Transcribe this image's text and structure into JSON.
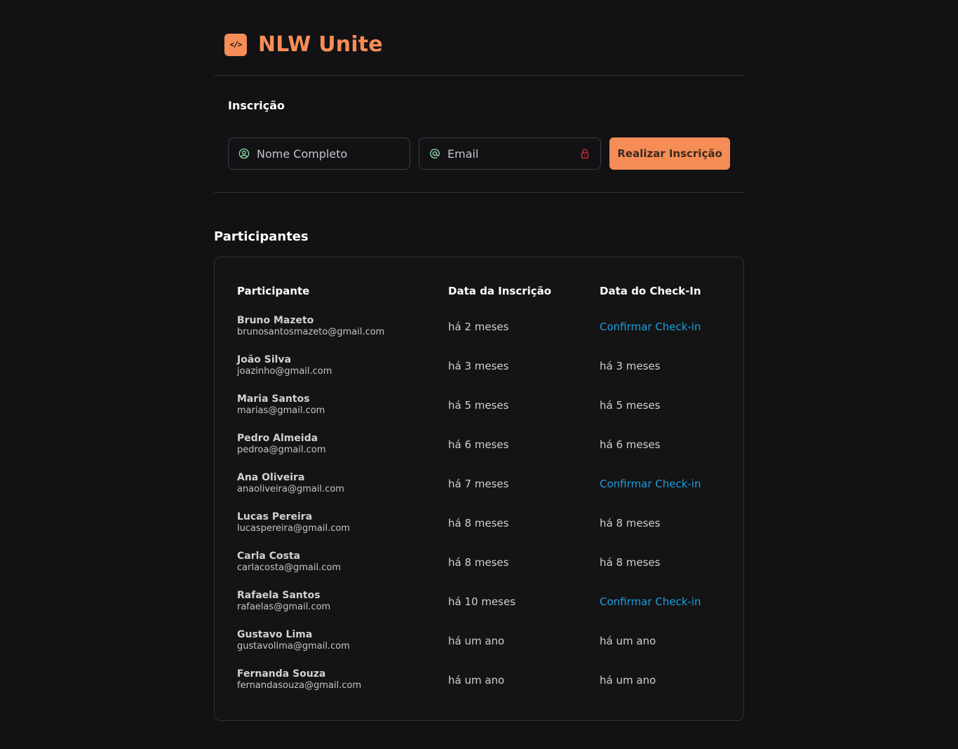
{
  "header": {
    "logo_glyph": "</>",
    "title": "NLW Unite"
  },
  "form": {
    "title": "Inscrição",
    "name_placeholder": "Nome Completo",
    "email_placeholder": "Email",
    "submit_label": "Realizar Inscrição",
    "icons": {
      "name": "user-circle-icon",
      "email": "at-sign-icon",
      "password_manager": "lock-icon"
    }
  },
  "participants": {
    "title": "Participantes",
    "columns": [
      "Participante",
      "Data da Inscrição",
      "Data do Check-In"
    ],
    "rows": [
      {
        "name": "Bruno Mazeto",
        "email": "brunosantosmazeto@gmail.com",
        "subscribed": "há 2 meses",
        "checkin": "Confirmar Check-in",
        "checkin_is_action": true
      },
      {
        "name": "João Silva",
        "email": "joazinho@gmail.com",
        "subscribed": "há 3 meses",
        "checkin": "há 3 meses",
        "checkin_is_action": false
      },
      {
        "name": "Maria Santos",
        "email": "marias@gmail.com",
        "subscribed": "há 5 meses",
        "checkin": "há 5 meses",
        "checkin_is_action": false
      },
      {
        "name": "Pedro Almeida",
        "email": "pedroa@gmail.com",
        "subscribed": "há 6 meses",
        "checkin": "há 6 meses",
        "checkin_is_action": false
      },
      {
        "name": "Ana Oliveira",
        "email": "anaoliveira@gmail.com",
        "subscribed": "há 7 meses",
        "checkin": "Confirmar Check-in",
        "checkin_is_action": true
      },
      {
        "name": "Lucas Pereira",
        "email": "lucaspereira@gmail.com",
        "subscribed": "há 8 meses",
        "checkin": "há 8 meses",
        "checkin_is_action": false
      },
      {
        "name": "Carla Costa",
        "email": "carlacosta@gmail.com",
        "subscribed": "há 8 meses",
        "checkin": "há 8 meses",
        "checkin_is_action": false
      },
      {
        "name": "Rafaela Santos",
        "email": "rafaelas@gmail.com",
        "subscribed": "há 10 meses",
        "checkin": "Confirmar Check-in",
        "checkin_is_action": true
      },
      {
        "name": "Gustavo Lima",
        "email": "gustavolima@gmail.com",
        "subscribed": "há um ano",
        "checkin": "há um ano",
        "checkin_is_action": false
      },
      {
        "name": "Fernanda Souza",
        "email": "fernandasouza@gmail.com",
        "subscribed": "há um ano",
        "checkin": "há um ano",
        "checkin_is_action": false
      }
    ]
  },
  "colors": {
    "background": "#121214",
    "accent": "#f68d56",
    "link": "#1a9fe0",
    "lock_icon": "#e0303a",
    "field_icon": "#8fd7a8"
  }
}
